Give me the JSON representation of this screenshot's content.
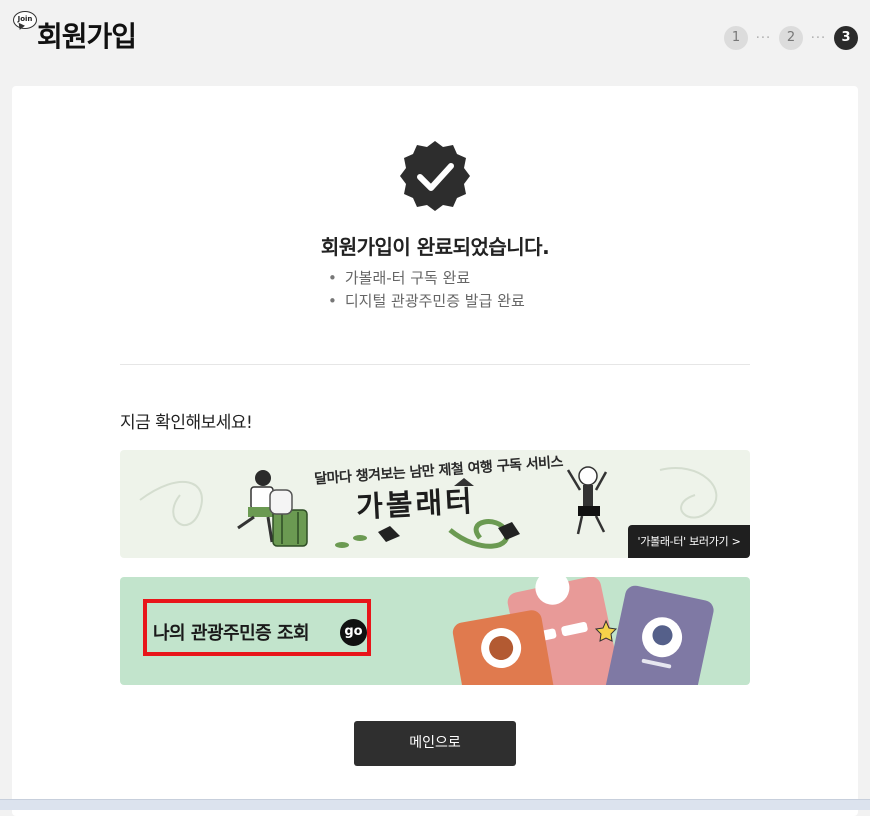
{
  "header": {
    "badge": "Join",
    "title": "회원가입",
    "steps": [
      "1",
      "2",
      "3"
    ],
    "active_step": 3,
    "step_dots": "···"
  },
  "complete": {
    "title": "회원가입이 완료되었습니다.",
    "items": [
      "가볼래-터 구독 완료",
      "디지털 관광주민증 발급 완료"
    ]
  },
  "check_now": "지금 확인해보세요!",
  "banner_subscription": {
    "subtitle": "달마다 챙겨보는 남만 제철 여행 구독 서비스",
    "title": "가볼래터",
    "link": "'가볼래-터' 보러가기 >"
  },
  "banner_resident_card": {
    "label": "나의 관광주민증 조회",
    "go": "go"
  },
  "main_button": "메인으로",
  "colors": {
    "dark": "#2f2f2f",
    "banner1_bg": "#eef3ea",
    "banner2_bg": "#c2e4cc",
    "highlight": "#e8151a"
  }
}
